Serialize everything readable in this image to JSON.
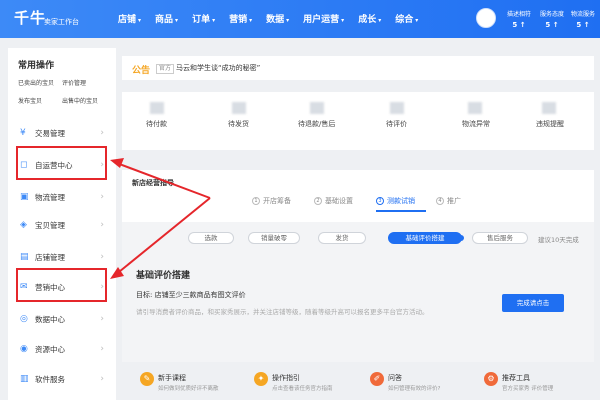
{
  "header": {
    "logo": "千牛",
    "logo_sub": "卖家工作台",
    "nav": [
      {
        "label": "店铺"
      },
      {
        "label": "商品"
      },
      {
        "label": "订单"
      },
      {
        "label": "营销"
      },
      {
        "label": "数据"
      },
      {
        "label": "用户运营"
      },
      {
        "label": "成长"
      },
      {
        "label": "综合"
      }
    ],
    "caret": "▾",
    "stats": [
      {
        "label": "描述相符",
        "value": "5 ↑"
      },
      {
        "label": "服务态度",
        "value": "5 ↑"
      },
      {
        "label": "物流服务",
        "value": "5 ↑"
      }
    ]
  },
  "sidebar": {
    "title": "常用操作",
    "quick_links": [
      "已卖出的宝贝",
      "评价管理",
      "发布宝贝",
      "出售中的宝贝"
    ],
    "items": [
      {
        "label": "交易管理",
        "icon": "¥"
      },
      {
        "label": "自运营中心",
        "icon": "◻"
      },
      {
        "label": "物流管理",
        "icon": "▣"
      },
      {
        "label": "宝贝管理",
        "icon": "◈"
      },
      {
        "label": "店铺管理",
        "icon": "▤"
      },
      {
        "label": "营销中心",
        "icon": "✉"
      },
      {
        "label": "数据中心",
        "icon": "◎"
      },
      {
        "label": "资源中心",
        "icon": "◉"
      },
      {
        "label": "软件服务",
        "icon": "▥"
      }
    ],
    "chevron": "›"
  },
  "notice": {
    "tag": "公告",
    "badge": "官方",
    "text": "马云和学生谈“成功的秘密”"
  },
  "counters": [
    {
      "label": "待付款"
    },
    {
      "label": "待发货"
    },
    {
      "label": "待退款/售后"
    },
    {
      "label": "待评价"
    },
    {
      "label": "物流异常"
    },
    {
      "label": "违规提醒"
    }
  ],
  "growth": {
    "title": "新店经营指导",
    "steps": [
      {
        "num": "1",
        "label": "开店筹备"
      },
      {
        "num": "2",
        "label": "基础设置"
      },
      {
        "num": "3",
        "label": "测款试销"
      },
      {
        "num": "4",
        "label": "推广"
      }
    ],
    "pills": [
      "选款",
      "销量破零",
      "发货",
      "基础评价搭建",
      "售后服务"
    ],
    "pill_note": "建议10天完成",
    "build_title": "基础评价搭建",
    "build_target": "目标: 店铺至少三款商品有图文评价",
    "build_desc": "请引导消费者评价商品，和买家秀展示，并关注店铺等级，随着等级升高可以报名更多平台官方活动。",
    "cta": "完成请点击"
  },
  "tools": [
    {
      "name": "新手课程",
      "desc": "如何做到优质好评不离散",
      "color": "#f5a623",
      "icon": "✎"
    },
    {
      "name": "操作指引",
      "desc": "点击查看该任务官方指南",
      "color": "#f5a623",
      "icon": "✦"
    },
    {
      "name": "问答",
      "desc": "如何管理有效的评价?",
      "color": "#f06a3a",
      "icon": "✐"
    },
    {
      "name": "推荐工具",
      "desc": "官方买家秀  评价管理",
      "color": "#f06a3a",
      "icon": "⚙"
    }
  ],
  "colors": {
    "accent": "#1f6ff2",
    "highlight": "#e5262b",
    "notice": "#f5a623"
  }
}
